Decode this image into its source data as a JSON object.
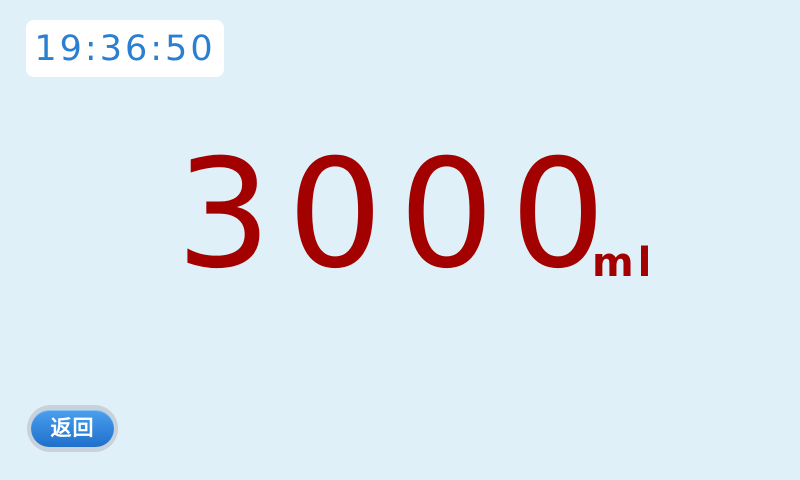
{
  "clock": {
    "time": "19:36:50"
  },
  "reading": {
    "value": "3000",
    "unit": "ml"
  },
  "controls": {
    "back_label": "返回"
  },
  "colors": {
    "background": "#dff0f8",
    "clock_text": "#2b7fd0",
    "value_text": "#a30000",
    "button": "#2a86dc"
  }
}
